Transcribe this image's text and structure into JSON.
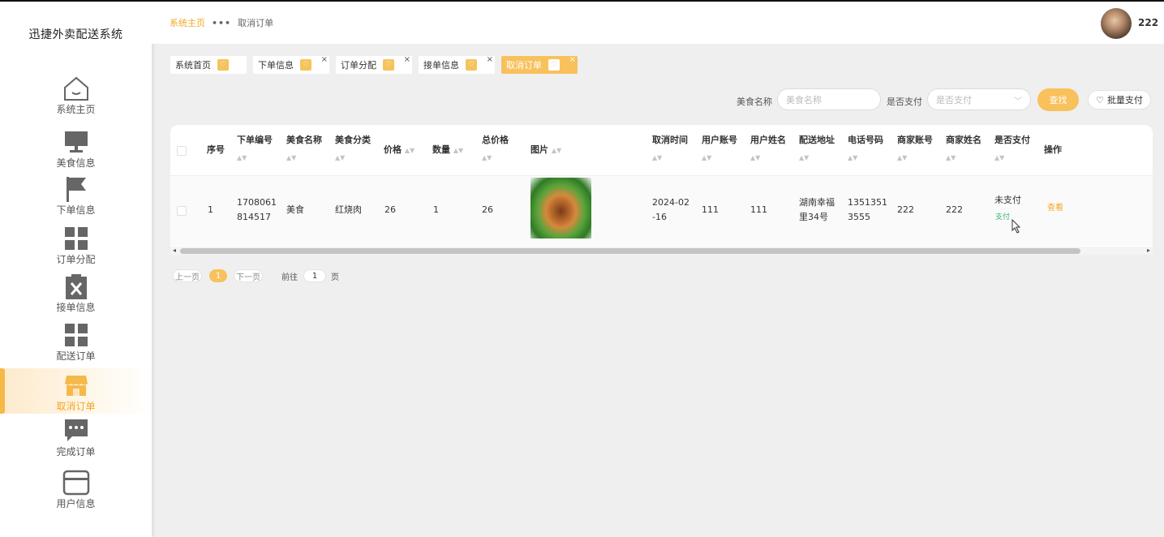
{
  "app": {
    "title": "迅捷外卖配送系统"
  },
  "sidebar": {
    "items": [
      {
        "label": "系统主页",
        "icon": "home-icon"
      },
      {
        "label": "美食信息",
        "icon": "monitor-icon"
      },
      {
        "label": "下单信息",
        "icon": "flag-icon"
      },
      {
        "label": "订单分配",
        "icon": "grid-icon"
      },
      {
        "label": "接单信息",
        "icon": "clipboard-x-icon"
      },
      {
        "label": "配送订单",
        "icon": "grid-icon"
      },
      {
        "label": "取消订单",
        "icon": "shop-icon",
        "active": true
      },
      {
        "label": "完成订单",
        "icon": "chat-icon"
      },
      {
        "label": "用户信息",
        "icon": "card-icon"
      }
    ]
  },
  "header": {
    "breadcrumb_home": "系统主页",
    "breadcrumb_sep": "•••",
    "breadcrumb_current": "取消订单",
    "username": "222"
  },
  "tabs": [
    {
      "label": "系统首页",
      "closable": false
    },
    {
      "label": "下单信息",
      "closable": true
    },
    {
      "label": "订单分配",
      "closable": true
    },
    {
      "label": "接单信息",
      "closable": true
    },
    {
      "label": "取消订单",
      "closable": true,
      "active": true
    }
  ],
  "search": {
    "food_label": "美食名称",
    "food_placeholder": "美食名称",
    "pay_label": "是否支付",
    "pay_placeholder": "是否支付",
    "search_button": "查找",
    "batch_button": "批量支付"
  },
  "table": {
    "headers": {
      "seq": "序号",
      "order_no": "下单编号",
      "food_name": "美食名称",
      "food_cat": "美食分类",
      "price": "价格",
      "qty": "数量",
      "total": "总价格",
      "image": "图片",
      "cancel_time": "取消时间",
      "user_acct": "用户账号",
      "user_name": "用户姓名",
      "address": "配送地址",
      "phone": "电话号码",
      "merchant_acct": "商家账号",
      "merchant_name": "商家姓名",
      "paid": "是否支付",
      "ops": "操作"
    },
    "rows": [
      {
        "seq": "1",
        "order_no_l1": "1708061",
        "order_no_l2": "814517",
        "food_name": "美食",
        "food_cat": "红烧肉",
        "price": "26",
        "qty": "1",
        "total": "26",
        "cancel_time_l1": "2024-02",
        "cancel_time_l2": "-16",
        "user_acct": "111",
        "user_name": "111",
        "address_l1": "湖南幸福",
        "address_l2": "里34号",
        "phone_l1": "1351351",
        "phone_l2": "3555",
        "merchant_acct": "222",
        "merchant_name": "222",
        "paid_status": "未支付",
        "pay_link": "支付",
        "view_link": "查看"
      }
    ]
  },
  "pagination": {
    "prev": "上一页",
    "current": "1",
    "next": "下一页",
    "goto_label": "前往",
    "goto_value": "1",
    "page_suffix": "页"
  },
  "colors": {
    "accent": "#f8c15c",
    "accent_text": "#f5a623",
    "pay_link": "#3bb36f"
  }
}
